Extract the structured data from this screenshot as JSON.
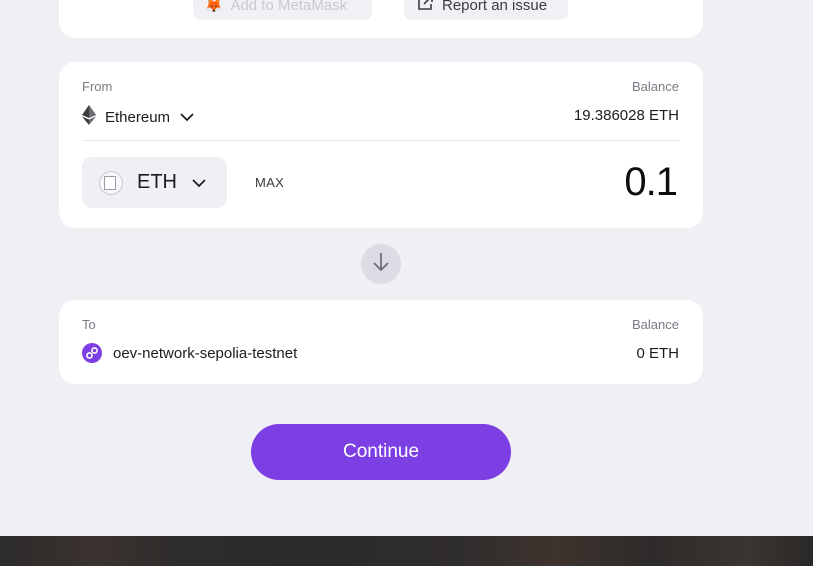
{
  "top_actions": {
    "add_metamask_label": "Add to MetaMask",
    "report_issue_label": "Report an issue"
  },
  "from": {
    "label": "From",
    "network": "Ethereum",
    "balance_label": "Balance",
    "balance_value": "19.386028 ETH",
    "token": "ETH",
    "max_label": "MAX",
    "amount": "0.1"
  },
  "to": {
    "label": "To",
    "network": "oev-network-sepolia-testnet",
    "balance_label": "Balance",
    "balance_value": "0 ETH"
  },
  "continue_label": "Continue",
  "icons": {
    "metamask": "metamask-fox-icon",
    "external": "external-link-icon",
    "ethereum": "ethereum-icon",
    "chevron": "chevron-down-icon",
    "arrow": "arrow-down-icon",
    "oev": "oev-network-icon"
  },
  "colors": {
    "accent": "#7b3fe4",
    "background": "#efeff4",
    "card": "#ffffff"
  }
}
